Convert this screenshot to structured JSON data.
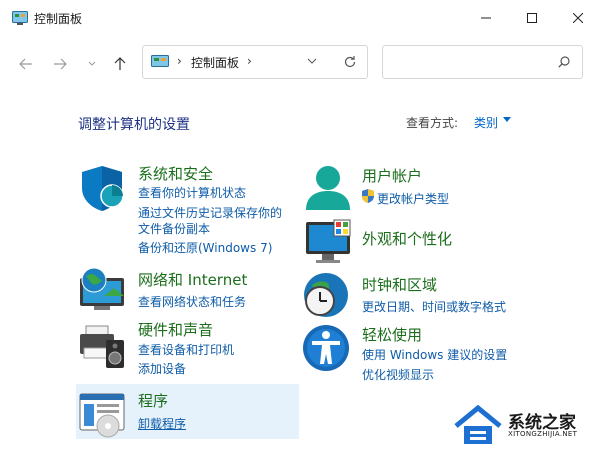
{
  "window": {
    "title": "控制面板"
  },
  "address": {
    "path": "控制面板"
  },
  "search": {
    "placeholder": ""
  },
  "main": {
    "heading": "调整计算机的设置",
    "view_by_label": "查看方式:",
    "view_by_value": "类别"
  },
  "categories": [
    {
      "title": "系统和安全",
      "links": [
        "查看你的计算机状态",
        "通过文件历史记录保存你的",
        "文件备份副本",
        "备份和还原(Windows 7)"
      ],
      "icon": "system-security-shield-icon"
    },
    {
      "title": "网络和 Internet",
      "links": [
        "查看网络状态和任务"
      ],
      "icon": "network-globe-icon"
    },
    {
      "title": "硬件和声音",
      "links": [
        "查看设备和打印机",
        "添加设备"
      ],
      "icon": "printer-speaker-icon"
    },
    {
      "title": "程序",
      "links": [
        "卸载程序"
      ],
      "icon": "programs-icon"
    },
    {
      "title": "用户帐户",
      "links": [
        "更改帐户类型"
      ],
      "icon": "user-accounts-icon"
    },
    {
      "title": "外观和个性化",
      "links": [],
      "icon": "appearance-monitor-icon"
    },
    {
      "title": "时钟和区域",
      "links": [
        "更改日期、时间或数字格式"
      ],
      "icon": "clock-globe-icon"
    },
    {
      "title": "轻松使用",
      "links": [
        "使用 Windows 建议的设置",
        "优化视频显示"
      ],
      "icon": "ease-of-access-icon"
    }
  ],
  "watermark": {
    "name": "系统之家",
    "url": "XITONGZHIJIA.NET"
  },
  "colors": {
    "category_title": "#1b6e1b",
    "link": "#0f5ca8",
    "heading": "#1e3287",
    "hover_bg": "#e5f1fb"
  }
}
